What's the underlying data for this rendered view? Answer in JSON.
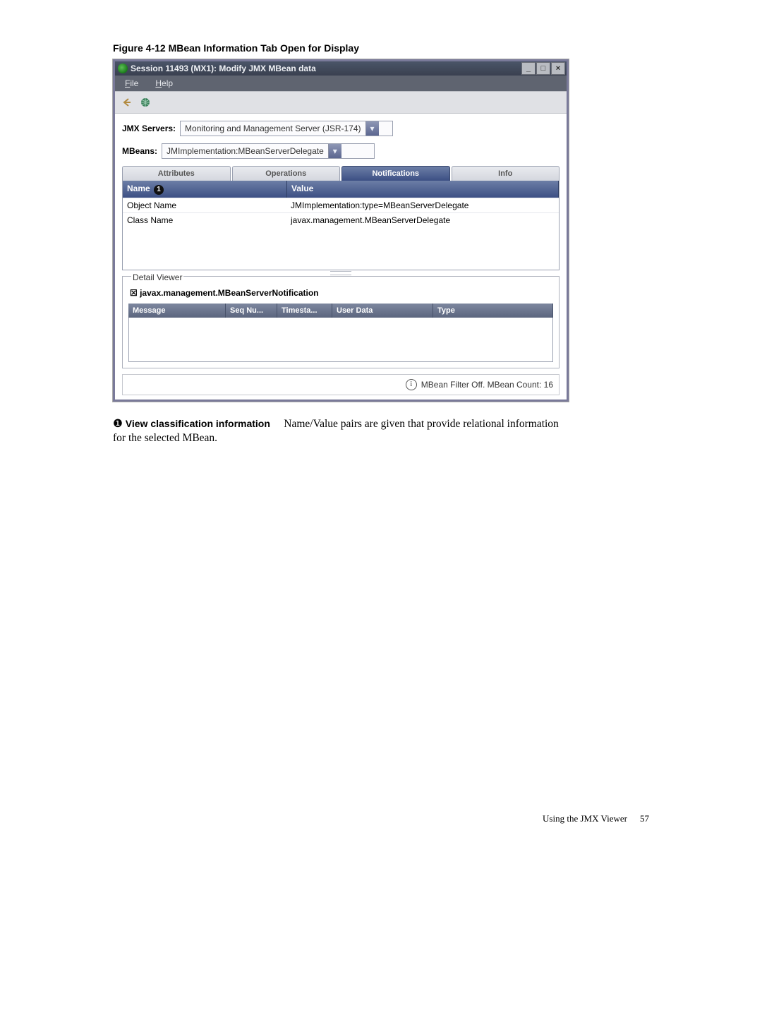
{
  "figure_caption": "Figure 4-12 MBean Information Tab Open for Display",
  "window": {
    "title": "Session 11493 (MX1):  Modify JMX MBean data",
    "menus": {
      "file": "File",
      "help": "Help"
    }
  },
  "selectors": {
    "jmx_label": "JMX Servers:",
    "jmx_value": "Monitoring and Management Server (JSR-174)",
    "mbeans_label": "MBeans:",
    "mbeans_value": "JMImplementation:MBeanServerDelegate"
  },
  "tabs": {
    "attributes": "Attributes",
    "operations": "Operations",
    "notifications": "Notifications",
    "info": "Info"
  },
  "infogrid": {
    "headers": {
      "name": "Name",
      "value": "Value"
    },
    "rows": [
      {
        "name": "Object Name",
        "value": "JMImplementation:type=MBeanServerDelegate"
      },
      {
        "name": "Class Name",
        "value": "javax.management.MBeanServerDelegate"
      }
    ]
  },
  "callout1": "1",
  "detail": {
    "legend": "Detail Viewer",
    "title": "☒ javax.management.MBeanServerNotification",
    "headers": {
      "message": "Message",
      "seq": "Seq Nu...",
      "timestamp": "Timesta...",
      "user": "User Data",
      "type": "Type"
    }
  },
  "statusbar": "MBean Filter Off. MBean Count: 16",
  "body": {
    "bullet": "❶",
    "lead": "View classification information",
    "rest1": "Name/Value pairs are given that provide relational information",
    "rest2": "for the selected MBean."
  },
  "footer": {
    "text": "Using the JMX Viewer",
    "page": "57"
  }
}
